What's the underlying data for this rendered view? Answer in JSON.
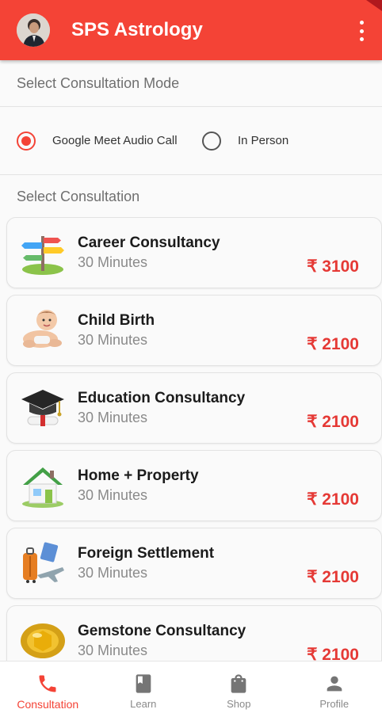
{
  "app": {
    "title": "SPS Astrology",
    "accent": "#f44336",
    "price_color": "#e53935"
  },
  "mode": {
    "heading": "Select Consultation Mode",
    "options": [
      {
        "label": "Google Meet Audio Call",
        "selected": true
      },
      {
        "label": "In Person",
        "selected": false
      }
    ]
  },
  "consultation": {
    "heading": "Select Consultation",
    "items": [
      {
        "title": "Career Consultancy",
        "duration": "30 Minutes",
        "price": "₹ 3100",
        "icon": "signpost-icon"
      },
      {
        "title": "Child Birth",
        "duration": "30 Minutes",
        "price": "₹ 2100",
        "icon": "baby-icon"
      },
      {
        "title": "Education Consultancy",
        "duration": "30 Minutes",
        "price": "₹ 2100",
        "icon": "graduation-cap-icon"
      },
      {
        "title": "Home + Property",
        "duration": "30 Minutes",
        "price": "₹ 2100",
        "icon": "house-icon"
      },
      {
        "title": "Foreign Settlement",
        "duration": "30 Minutes",
        "price": "₹ 2100",
        "icon": "luggage-plane-icon"
      },
      {
        "title": "Gemstone Consultancy",
        "duration": "30 Minutes",
        "price": "₹ 2100",
        "icon": "gemstone-icon"
      }
    ]
  },
  "nav": {
    "items": [
      {
        "label": "Consultation",
        "icon": "phone-icon",
        "active": true
      },
      {
        "label": "Learn",
        "icon": "book-icon",
        "active": false
      },
      {
        "label": "Shop",
        "icon": "shopping-bag-icon",
        "active": false
      },
      {
        "label": "Profile",
        "icon": "person-icon",
        "active": false
      }
    ]
  }
}
